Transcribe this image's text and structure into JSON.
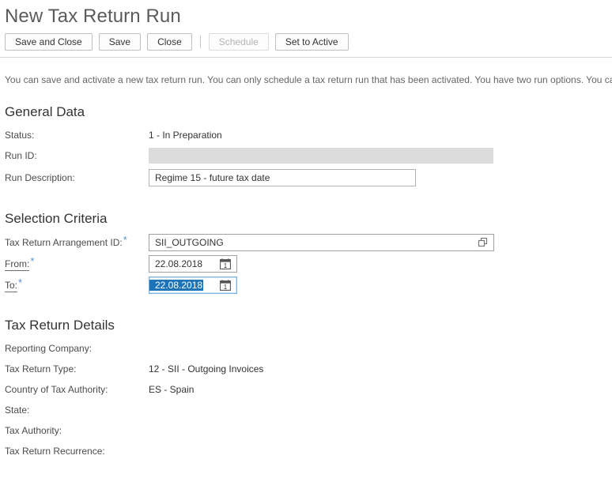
{
  "page": {
    "title": "New Tax Return Run",
    "intro": "You can save and activate a new tax return run. You can only schedule a tax return run that has been activated. You have two run options. You can"
  },
  "toolbar": {
    "buttons": [
      {
        "label": "Save and Close",
        "enabled": true
      },
      {
        "label": "Save",
        "enabled": true
      },
      {
        "label": "Close",
        "enabled": true
      },
      {
        "label": "Schedule",
        "enabled": false
      },
      {
        "label": "Set to Active",
        "enabled": true
      }
    ]
  },
  "general_data": {
    "heading": "General Data",
    "status_label": "Status:",
    "status_value": "1 - In Preparation",
    "run_id_label": "Run ID:",
    "run_id_value": "",
    "run_description_label": "Run Description:",
    "run_description_value": "Regime 15 - future tax date"
  },
  "selection_criteria": {
    "heading": "Selection Criteria",
    "arrangement_label": "Tax Return Arrangement ID:",
    "arrangement_required": "*",
    "arrangement_value": "SII_OUTGOING",
    "from_label": "From:",
    "from_required": "*",
    "from_value": "22.08.2018",
    "to_label": "To:",
    "to_required": "*",
    "to_value": "22.08.2018"
  },
  "tax_return_details": {
    "heading": "Tax Return Details",
    "fields": [
      {
        "label": "Reporting Company:",
        "value": ""
      },
      {
        "label": "Tax Return Type:",
        "value": "12 - SII - Outgoing Invoices"
      },
      {
        "label": "Country of Tax Authority:",
        "value": "ES - Spain"
      },
      {
        "label": "State:",
        "value": ""
      },
      {
        "label": "Tax Authority:",
        "value": ""
      },
      {
        "label": "Tax Return Recurrence:",
        "value": ""
      }
    ]
  },
  "colors": {
    "required_asterisk": "#5894c8",
    "selection_highlight": "#1d74b8",
    "focus_border": "#7cb4e0",
    "readonly_field": "#dcdcdc",
    "title_text": "#5b5b5b"
  }
}
